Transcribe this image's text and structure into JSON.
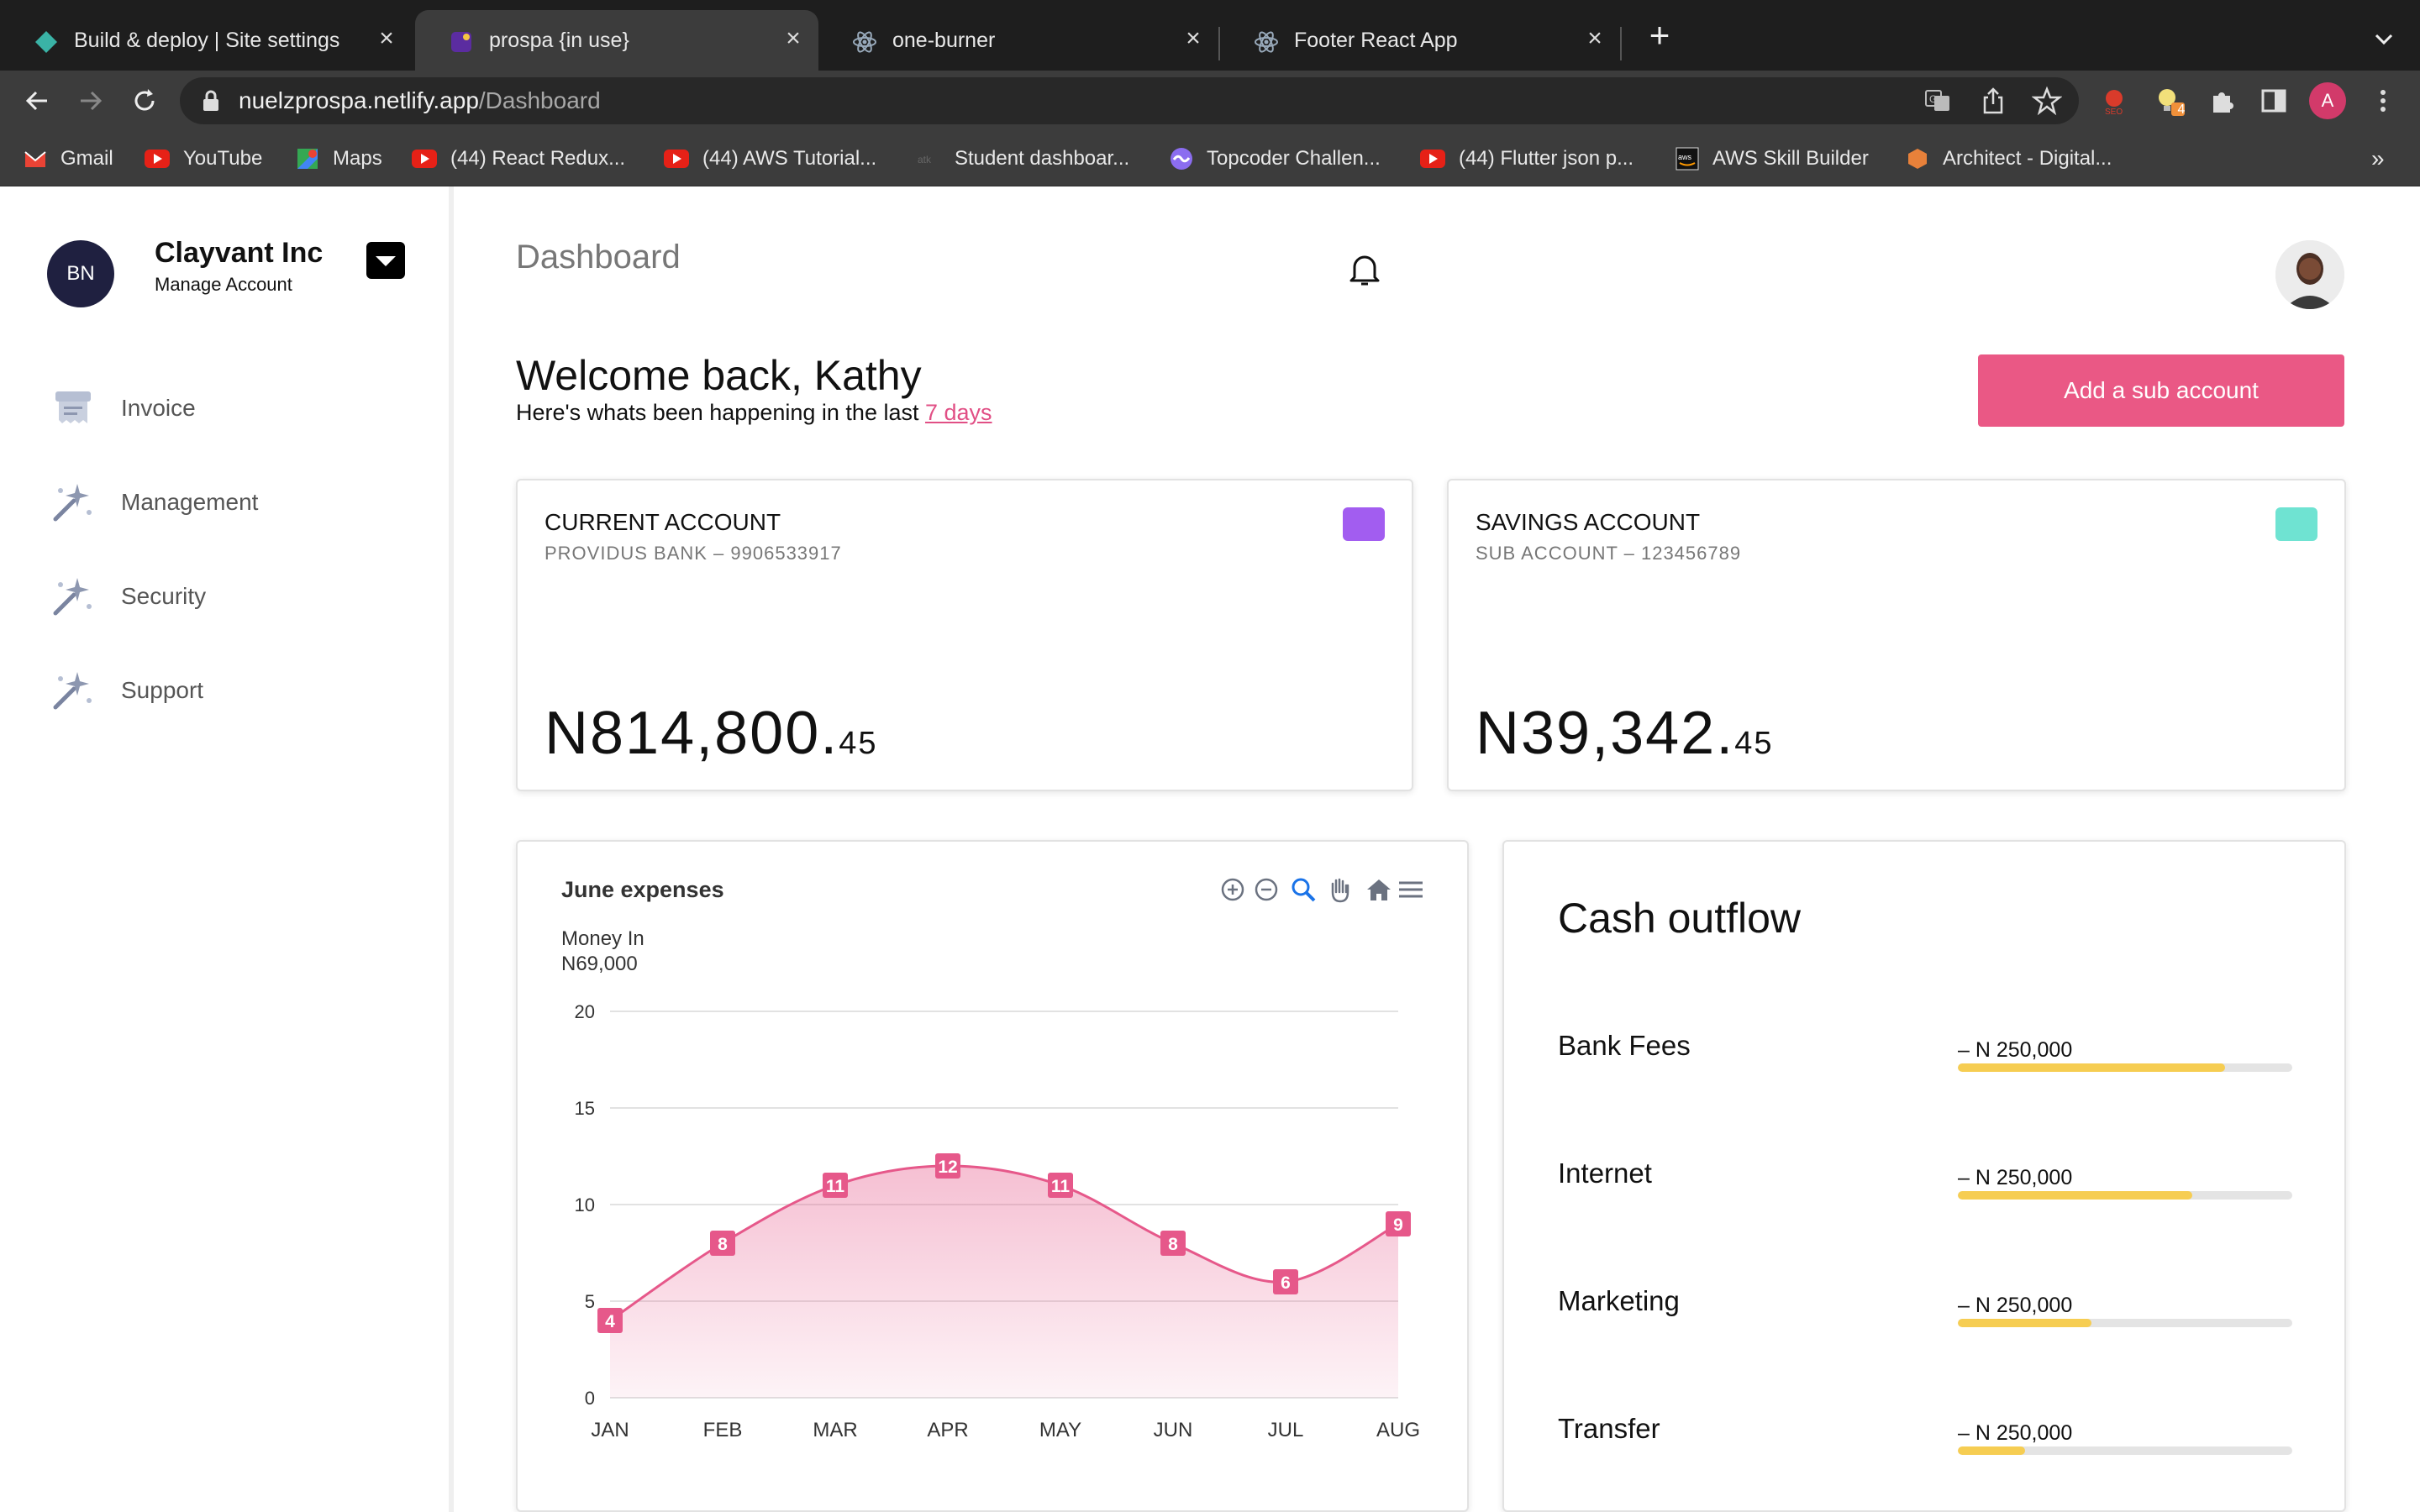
{
  "browser": {
    "tabs": [
      {
        "title": "Build & deploy | Site settings",
        "active": false,
        "icon": "netlify-icon"
      },
      {
        "title": "prospa {in use}",
        "active": true,
        "icon": "prospa-icon"
      },
      {
        "title": "one-burner",
        "active": false,
        "icon": "react-icon"
      },
      {
        "title": "Footer React App",
        "active": false,
        "icon": "react-icon"
      }
    ],
    "url_host": "nuelzprospa.netlify.app",
    "url_path": "/Dashboard",
    "profile_initial": "A",
    "extension_badge": "4",
    "bookmarks": [
      {
        "label": "Gmail",
        "icon": "gmail-icon"
      },
      {
        "label": "YouTube",
        "icon": "youtube-icon"
      },
      {
        "label": "Maps",
        "icon": "maps-icon"
      },
      {
        "label": "(44) React Redux...",
        "icon": "youtube-icon"
      },
      {
        "label": "(44) AWS Tutorial...",
        "icon": "youtube-icon"
      },
      {
        "label": "Student dashboar...",
        "icon": "site-icon"
      },
      {
        "label": "Topcoder Challen...",
        "icon": "topcoder-icon"
      },
      {
        "label": "(44) Flutter json p...",
        "icon": "youtube-icon"
      },
      {
        "label": "AWS Skill Builder",
        "icon": "aws-icon"
      },
      {
        "label": "Architect - Digital...",
        "icon": "architect-icon"
      }
    ],
    "bookmarks_overflow": "»"
  },
  "sidebar": {
    "avatar_initials": "BN",
    "company": "Clayvant Inc",
    "manage": "Manage Account",
    "items": [
      {
        "label": "Invoice",
        "icon": "invoice-icon"
      },
      {
        "label": "Management",
        "icon": "magic-wand-icon"
      },
      {
        "label": "Security",
        "icon": "magic-wand-icon"
      },
      {
        "label": "Support",
        "icon": "magic-wand-icon"
      }
    ]
  },
  "header": {
    "title": "Dashboard",
    "welcome": "Welcome back, Kathy",
    "subtitle_prefix": "Here's whats been happening in the last ",
    "subtitle_link": "7 days",
    "add_button": "Add a sub account"
  },
  "accounts": [
    {
      "name": "CURRENT ACCOUNT",
      "sub": "PROVIDUS BANK – 9906533917",
      "balance_main": "N814,800.",
      "balance_cents": "45",
      "color": "#a25df0"
    },
    {
      "name": "SAVINGS ACCOUNT",
      "sub": "SUB ACCOUNT – 123456789",
      "balance_main": "N39,342.",
      "balance_cents": "45",
      "color": "#6fe3d2"
    }
  ],
  "chart_data": {
    "type": "area",
    "title": "June expenses",
    "money_in_label": "Money In",
    "money_in_value": "N69,000",
    "categories": [
      "JAN",
      "FEB",
      "MAR",
      "APR",
      "MAY",
      "JUN",
      "JUL",
      "AUG"
    ],
    "series": [
      {
        "values": [
          4,
          8,
          11,
          12,
          11,
          8,
          6,
          9
        ]
      }
    ],
    "ylim": [
      0,
      20
    ],
    "yticks": [
      0,
      5,
      10,
      15,
      20
    ],
    "xlabel": "",
    "ylabel": "",
    "grid": true,
    "color": "#e6588a",
    "toolbar_icons": [
      "zoom-in-icon",
      "zoom-out-icon",
      "selection-zoom-icon",
      "pan-icon",
      "reset-home-icon",
      "menu-icon"
    ]
  },
  "cash_outflow": {
    "title": "Cash outflow",
    "items": [
      {
        "label": "Bank Fees",
        "amount": "– N 250,000",
        "progress": 0.8
      },
      {
        "label": "Internet",
        "amount": "– N 250,000",
        "progress": 0.7
      },
      {
        "label": "Marketing",
        "amount": "– N 250,000",
        "progress": 0.4
      },
      {
        "label": "Transfer",
        "amount": "– N 250,000",
        "progress": 0.2
      }
    ],
    "bar_color": "#f6cd52"
  }
}
